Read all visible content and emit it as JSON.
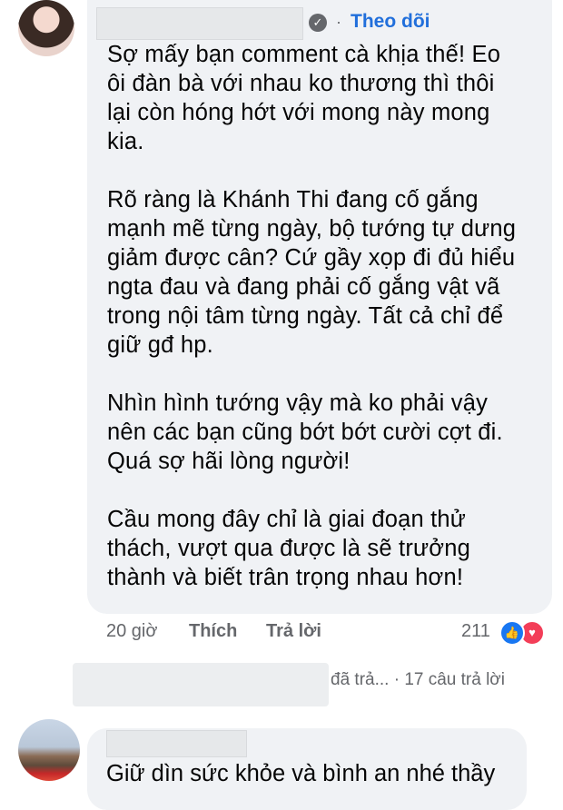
{
  "comment": {
    "follow_label": "Theo dõi",
    "verified_icon": "✓",
    "body": "Sợ mấy bạn comment cà khịa thế! Eo\nôi đàn bà với nhau ko thương thì thôi\nlại còn hóng hớt với mong này mong\nkia.\n\nRõ ràng là Khánh Thi đang cố gắng\nmạnh mẽ từng ngày, bộ tướng tự dưng\ngiảm được cân? Cứ gầy xọp đi đủ hiểu\nngta đau và đang phải cố gắng vật vã\ntrong nội tâm từng ngày. Tất cả chỉ để\ngiữ gđ hp.\n\nNhìn hình tướng vậy mà ko phải vậy\nnên các bạn cũng bớt bớt cười cợt đi.\nQuá sợ hãi lòng người!\n\nCầu mong đây chỉ là giai đoạn thử\nthách, vượt qua được là sẽ trưởng\nthành và biết trân trọng nhau hơn!",
    "time": "20 giờ",
    "like_label": "Thích",
    "reply_label": "Trả lời",
    "reaction_count": "211",
    "reactions": {
      "like_icon": "👍",
      "love_icon": "♥"
    }
  },
  "replies_summary": {
    "replied_text": "đã trả...",
    "separator": "·",
    "count_text": "17 câu trả lời"
  },
  "comment2": {
    "body": "Giữ dìn sức khỏe và bình an nhé thầy"
  },
  "colors": {
    "bubble": "#f0f2f5",
    "link": "#216fdb",
    "meta": "#65676b",
    "like": "#1877f2",
    "love": "#f33e58"
  }
}
